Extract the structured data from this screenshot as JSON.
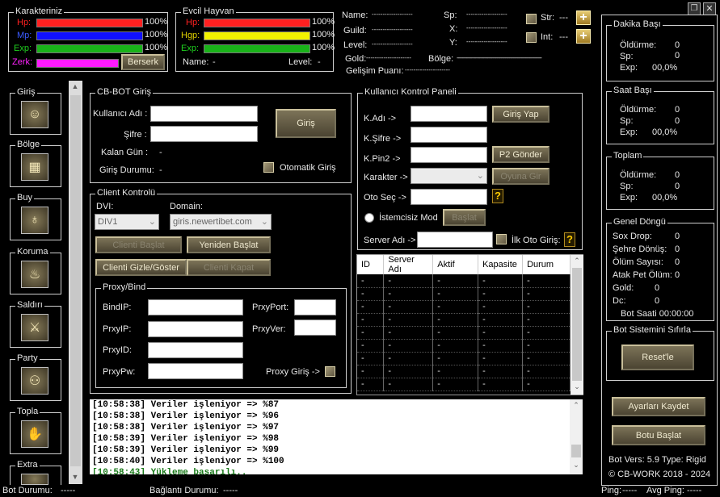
{
  "window_controls": [
    "restore",
    "close"
  ],
  "karakter": {
    "title": "Karakteriniz",
    "hp": {
      "label": "Hp:",
      "value": "100%",
      "fill": 1.0
    },
    "mp": {
      "label": "Mp:",
      "value": "100%",
      "fill": 1.0
    },
    "exp": {
      "label": "Exp:",
      "value": "100%",
      "fill": 1.0
    },
    "zerk": {
      "label": "Zerk:",
      "fill": 1.0
    },
    "berserk_button": "Berserk"
  },
  "pet": {
    "title": "Evcil Hayvan",
    "hp": {
      "label": "Hp:",
      "value": "100%",
      "fill": 1.0
    },
    "hgp": {
      "label": "Hgp:",
      "value": "100%",
      "fill": 1.0
    },
    "exp": {
      "label": "Exp:",
      "value": "100%",
      "fill": 1.0
    },
    "name_label": "Name:",
    "name_value": "-",
    "level_label": "Level:",
    "level_value": "-"
  },
  "info": {
    "name_label": "Name:",
    "name_value": "-------------------",
    "guild_label": "Guild:",
    "guild_value": "-------------------",
    "level_label": "Level:",
    "level_value": "-------------------",
    "gold_label": "Gold:",
    "gold_value": "---------------------",
    "gelisim_label": "Gelişim Puanı:",
    "gelisim_value": "---------------------",
    "sp_label": "Sp:",
    "sp_value": "-------------------",
    "x_label": "X:",
    "x_value": "-------------------",
    "y_label": "Y:",
    "y_value": "-------------------",
    "bolge_label": "Bölge:",
    "bolge_value": "---------------------------------------------------------------",
    "str_label": "Str:",
    "str_value": "---",
    "int_label": "Int:",
    "int_value": "---"
  },
  "sidebar": [
    {
      "label": "Giriş",
      "icon": "user-icon"
    },
    {
      "label": "Bölge",
      "icon": "map-icon"
    },
    {
      "label": "Buy",
      "icon": "bag-icon"
    },
    {
      "label": "Koruma",
      "icon": "potion-icon"
    },
    {
      "label": "Saldırı",
      "icon": "sword-icon"
    },
    {
      "label": "Party",
      "icon": "party-icon"
    },
    {
      "label": "Topla",
      "icon": "hand-icon"
    },
    {
      "label": "Extra",
      "icon": "extra-icon"
    }
  ],
  "cbbot": {
    "title": "CB-BOT Giriş",
    "kullanici_label": "Kullanıcı Adı :",
    "kullanici_value": "",
    "sifre_label": "Şifre :",
    "sifre_value": "",
    "kalan_label": "Kalan Gün :",
    "kalan_value": "-",
    "durum_label": "Giriş Durumu:",
    "durum_value": "-",
    "giris_button": "Giriş",
    "otomatik_label": "Otomatik Giriş"
  },
  "client": {
    "title": "Client Kontrolü",
    "dvi_label": "DVI:",
    "dvi_value": "DIV1",
    "domain_label": "Domain:",
    "domain_value": "giris.newertibet.com",
    "btn_baslat": "Clienti Başlat",
    "btn_yeniden": "Yeniden Başlat",
    "btn_gizle": "Clienti Gizle/Göster",
    "btn_kapat": "Clienti Kapat",
    "proxy": {
      "title": "Proxy/Bind",
      "bindip_label": "BindIP:",
      "pxyip_label": "PrxyIP:",
      "pxyid_label": "PrxyID:",
      "pxypw_label": "PrxyPw:",
      "pxyport_label": "PrxyPort:",
      "pxyver_label": "PrxyVer:",
      "proxy_giris_label": "Proxy Giriş ->"
    }
  },
  "kullanici_panel": {
    "title": "Kullanıcı Kontrol Paneli",
    "kadi_label": "K.Adı ->",
    "ksifre_label": "K.Şifre ->",
    "kpin2_label": "K.Pin2 ->",
    "karakter_label": "Karakter ->",
    "otosec_label": "Oto Seç ->",
    "istemcisiz_label": "İstemcisiz Mod",
    "server_label": "Server Adı ->",
    "ilk_oto_label": "İlk Oto Giriş:",
    "btn_giris_yap": "Giriş Yap",
    "btn_p2": "P2 Gönder",
    "btn_oyuna": "Oyuna Gir",
    "btn_baslat": "Başlat"
  },
  "server_table": {
    "columns": [
      "ID",
      "Server Adı",
      "Aktif",
      "Kapasite",
      "Durum"
    ],
    "rows": [
      [
        "-",
        "-",
        "-",
        "-",
        "-"
      ],
      [
        "-",
        "-",
        "-",
        "-",
        "-"
      ],
      [
        "-",
        "-",
        "-",
        "-",
        "-"
      ],
      [
        "-",
        "-",
        "-",
        "-",
        "-"
      ],
      [
        "-",
        "-",
        "-",
        "-",
        "-"
      ],
      [
        "-",
        "-",
        "-",
        "-",
        "-"
      ],
      [
        "-",
        "-",
        "-",
        "-",
        "-"
      ],
      [
        "-",
        "-",
        "-",
        "-",
        "-"
      ],
      [
        "-",
        "-",
        "-",
        "-",
        "-"
      ]
    ]
  },
  "log": [
    {
      "text": "[10:58:38] Veriler işleniyor => %87",
      "ok": false
    },
    {
      "text": "[10:58:38] Veriler işleniyor => %96",
      "ok": false
    },
    {
      "text": "[10:58:38] Veriler işleniyor => %97",
      "ok": false
    },
    {
      "text": "[10:58:39] Veriler işleniyor => %98",
      "ok": false
    },
    {
      "text": "[10:58:39] Veriler işleniyor => %99",
      "ok": false
    },
    {
      "text": "[10:58:40] Veriler işleniyor => %100",
      "ok": false
    },
    {
      "text": "[10:58:43] Yükleme başarılı..",
      "ok": true
    }
  ],
  "stats": {
    "dakika": {
      "title": "Dakika Başı",
      "oldurme_label": "Öldürme:",
      "oldurme": "0",
      "sp_label": "Sp:",
      "sp": "0",
      "exp_label": "Exp:",
      "exp": "00,0%"
    },
    "saat": {
      "title": "Saat Başı",
      "oldurme_label": "Öldürme:",
      "oldurme": "0",
      "sp_label": "Sp:",
      "sp": "0",
      "exp_label": "Exp:",
      "exp": "00,0%"
    },
    "toplam": {
      "title": "Toplam",
      "oldurme_label": "Öldürme:",
      "oldurme": "0",
      "sp_label": "Sp:",
      "sp": "0",
      "exp_label": "Exp:",
      "exp": "00,0%"
    }
  },
  "genel": {
    "title": "Genel Döngü",
    "sox_label": "Sox Drop:",
    "sox": "0",
    "sehre_label": "Şehre Dönüş:",
    "sehre": "0",
    "olum_label": "Ölüm Sayısı:",
    "olum": "0",
    "atak_label": "Atak Pet Ölüm:",
    "atak": "0",
    "gold_label": "Gold:",
    "gold": "0",
    "dc_label": "Dc:",
    "dc": "0",
    "bot_saati": "Bot Saati 00:00:00"
  },
  "reset": {
    "title": "Bot Sistemini Sıfırla",
    "button": "Reset'le"
  },
  "ayarlari_kaydet": "Ayarları Kaydet",
  "botu_baslat": "Botu Başlat",
  "version": "Bot Vers: 5.9  Type: Rigid",
  "copyright": "©  CB-WORK 2018 - 2024",
  "status": {
    "bot_label": "Bot Durumu:",
    "bot_value": "-----",
    "baglanti_label": "Bağlantı Durumu:",
    "baglanti_value": "-----",
    "ping_label": "Ping:",
    "ping_value": "-----",
    "avg_label": "Avg Ping:",
    "avg_value": "-----"
  },
  "colors": {
    "hp": "#ff2020",
    "mp": "#1010ff",
    "exp": "#19b319",
    "zerk": "#ff1aff",
    "hgp": "#f2f200"
  }
}
